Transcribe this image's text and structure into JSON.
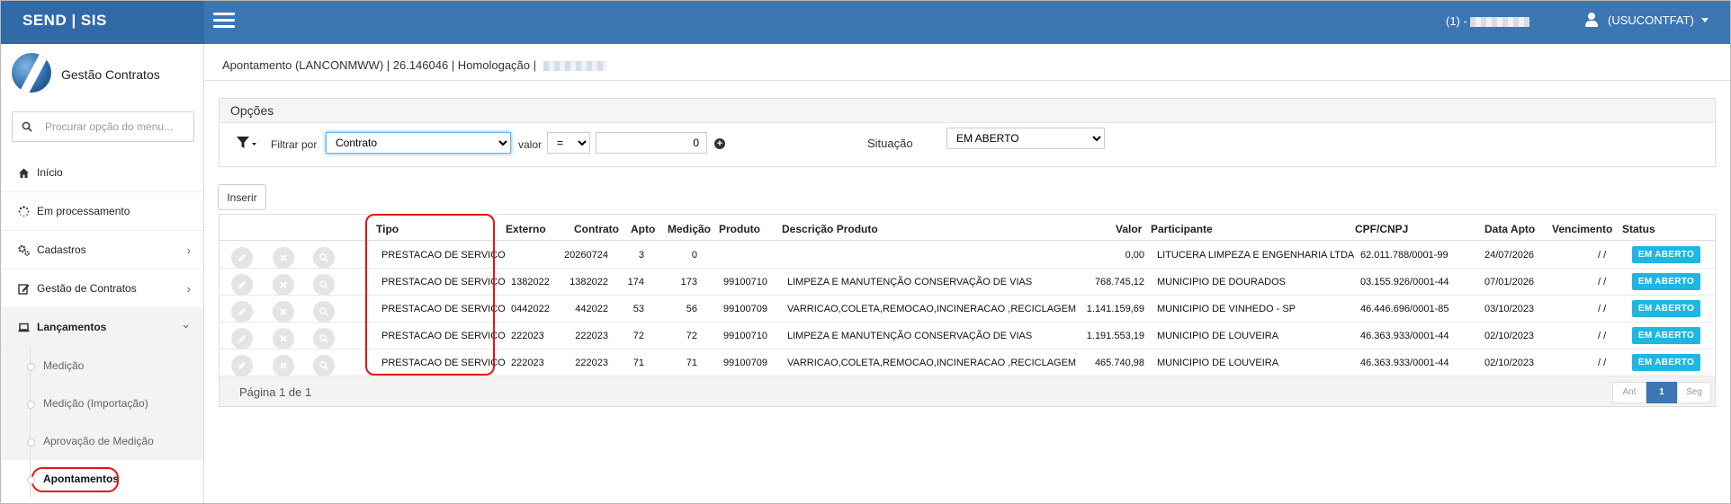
{
  "app": {
    "brand": "SEND | SIS"
  },
  "topbar": {
    "company_prefix": "(1) -",
    "user_label": "(USUCONTFAT)"
  },
  "sidebar": {
    "title": "Gestão Contratos",
    "search_placeholder": "Procurar opção do menu...",
    "items": [
      {
        "label": "Início",
        "icon": "home-icon"
      },
      {
        "label": "Em processamento",
        "icon": "spinner-icon"
      },
      {
        "label": "Cadastros",
        "icon": "gears-icon",
        "chevron": "›"
      },
      {
        "label": "Gestão de Contratos",
        "icon": "edit-icon",
        "chevron": "›"
      },
      {
        "label": "Lançamentos",
        "icon": "laptop-icon",
        "chevron": "⌄"
      }
    ],
    "subitems": [
      {
        "label": "Medição"
      },
      {
        "label": "Medição (Importação)"
      },
      {
        "label": "Aprovação de Medição"
      },
      {
        "label": "Apontamentos"
      }
    ]
  },
  "breadcrumb": {
    "text": "Apontamento (LANCONMWW) | 26.146046 | Homologação |"
  },
  "options": {
    "title": "Opções",
    "filter_label": "Filtrar por",
    "filter_value": "Contrato",
    "valor_label": "valor",
    "operator": "=",
    "valor_value": "0",
    "situacao_label": "Situação",
    "situacao_value": "EM ABERTO"
  },
  "toolbar": {
    "insert_label": "Inserir"
  },
  "grid": {
    "columns": {
      "tipo": "Tipo",
      "externo": "Externo",
      "contrato": "Contrato",
      "apto": "Apto",
      "medicao": "Medição",
      "produto": "Produto",
      "descricao": "Descrição Produto",
      "valor": "Valor",
      "participante": "Participante",
      "cpf": "CPF/CNPJ",
      "data": "Data Apto",
      "vencimento": "Vencimento",
      "status": "Status"
    },
    "rows": [
      {
        "tipo": "PRESTACAO DE SERVICO",
        "externo": "",
        "contrato": "20260724",
        "apto": "3",
        "medicao": "0",
        "produto": "",
        "descricao": "",
        "valor": "0,00",
        "participante": "LITUCERA LIMPEZA E ENGENHARIA LTDA",
        "cpf": "62.011.788/0001-99",
        "data": "24/07/2026",
        "vencimento": "/ /",
        "status": "EM ABERTO"
      },
      {
        "tipo": "PRESTACAO DE SERVICO",
        "externo": "1382022",
        "contrato": "1382022",
        "apto": "174",
        "medicao": "173",
        "produto": "99100710",
        "descricao": "LIMPEZA E MANUTENÇÃO CONSERVAÇÃO DE VIAS",
        "valor": "768.745,12",
        "participante": "MUNICIPIO DE DOURADOS",
        "cpf": "03.155.926/0001-44",
        "data": "07/01/2026",
        "vencimento": "/ /",
        "status": "EM ABERTO"
      },
      {
        "tipo": "PRESTACAO DE SERVICO",
        "externo": "0442022",
        "contrato": "442022",
        "apto": "53",
        "medicao": "56",
        "produto": "99100709",
        "descricao": "VARRICAO,COLETA,REMOCAO,INCINERACAO ,RECICLAGEM",
        "valor": "1.141.159,69",
        "participante": "MUNICIPIO DE VINHEDO - SP",
        "cpf": "46.446.696/0001-85",
        "data": "03/10/2023",
        "vencimento": "/ /",
        "status": "EM ABERTO"
      },
      {
        "tipo": "PRESTACAO DE SERVICO",
        "externo": "222023",
        "contrato": "222023",
        "apto": "72",
        "medicao": "72",
        "produto": "99100710",
        "descricao": "LIMPEZA E MANUTENÇÃO CONSERVAÇÃO DE VIAS",
        "valor": "1.191.553,19",
        "participante": "MUNICIPIO DE LOUVEIRA",
        "cpf": "46.363.933/0001-44",
        "data": "02/10/2023",
        "vencimento": "/ /",
        "status": "EM ABERTO"
      },
      {
        "tipo": "PRESTACAO DE SERVICO",
        "externo": "222023",
        "contrato": "222023",
        "apto": "71",
        "medicao": "71",
        "produto": "99100709",
        "descricao": "VARRICAO,COLETA,REMOCAO,INCINERACAO ,RECICLAGEM",
        "valor": "465.740,98",
        "participante": "MUNICIPIO DE LOUVEIRA",
        "cpf": "46.363.933/0001-44",
        "data": "02/10/2023",
        "vencimento": "/ /",
        "status": "EM ABERTO"
      }
    ],
    "page_info": "Página 1 de 1",
    "pager": {
      "prev": "Ant",
      "current": "1",
      "next": "Seg"
    }
  },
  "colors": {
    "topbar": "#3c76b3",
    "brand_bg": "#316aa7",
    "badge": "#1eb6e3",
    "highlight": "#e1141b"
  }
}
